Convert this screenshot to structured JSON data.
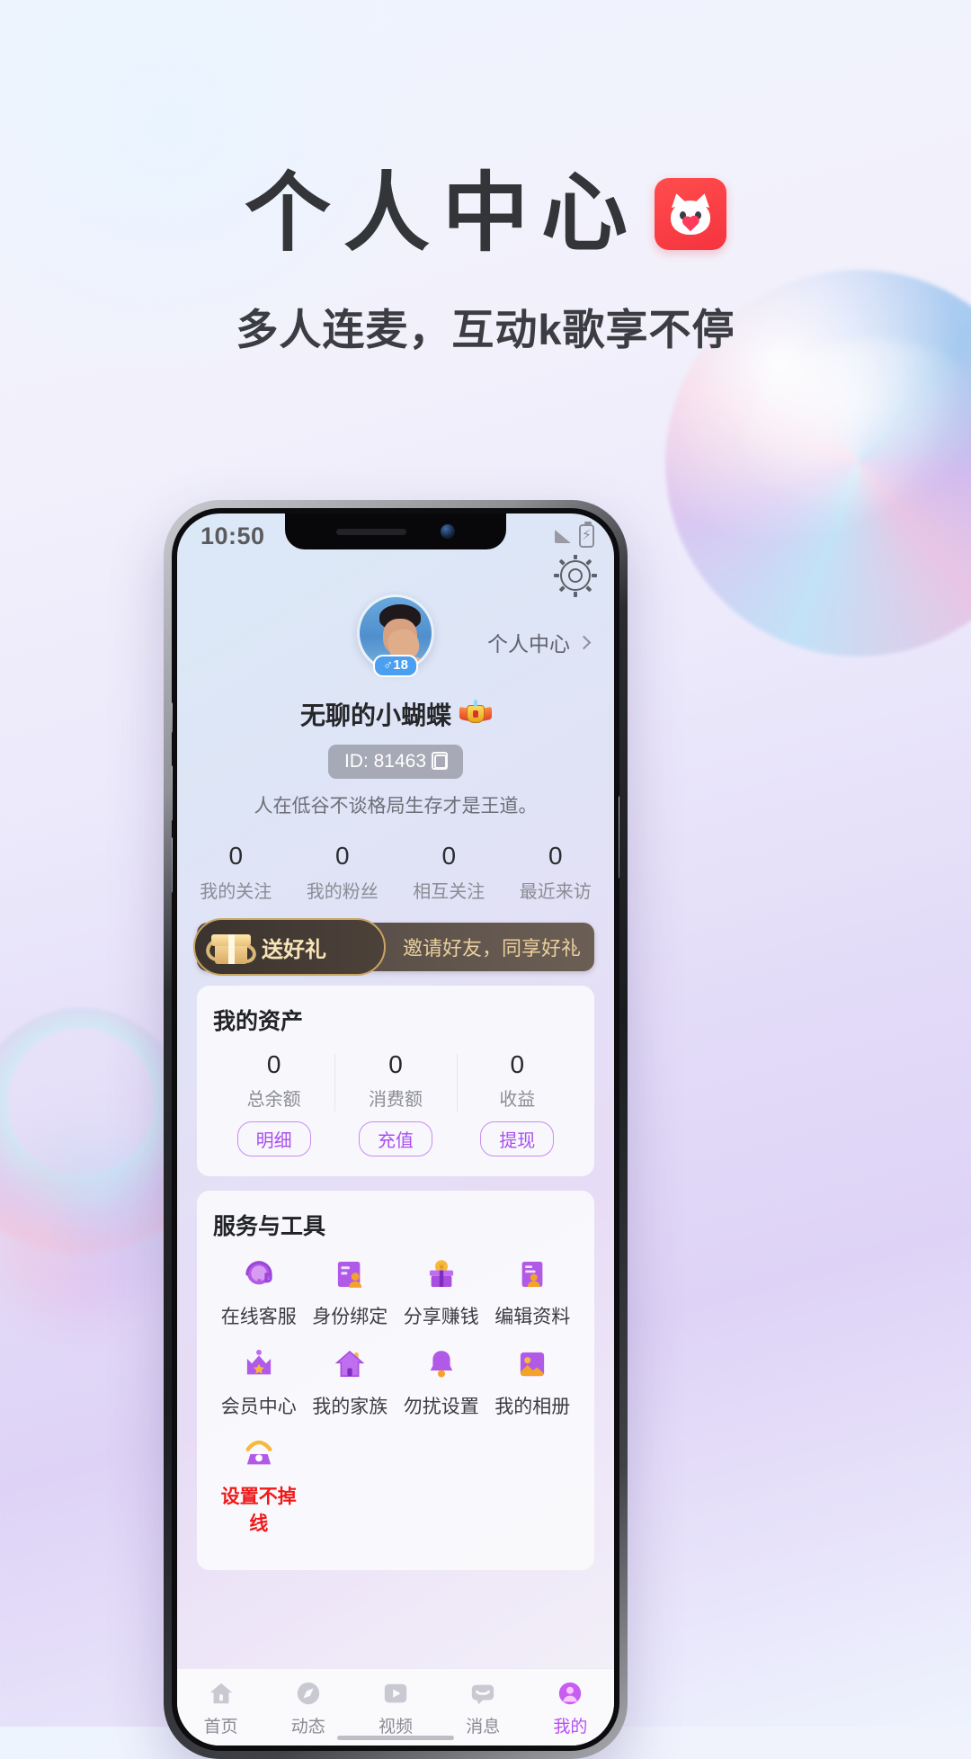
{
  "hero": {
    "title": "个人中心",
    "subtitle": "多人连麦，互动k歌享不停",
    "logo_icon": "cat-logo-icon",
    "title_color": "#333538",
    "logo_color": "#f5333f"
  },
  "phone": {
    "statusbar": {
      "time": "10:50",
      "signal_icon": "signal-icon",
      "battery_icon": "battery-charging-icon"
    },
    "settings_icon": "gear-icon",
    "profile": {
      "avatar_icon": "user-avatar",
      "gender_badge": "♂18",
      "personal_center_link": "个人中心",
      "chevron_icon": "chevron-right-icon",
      "nickname": "无聊的小蝴蝶",
      "level_badge_icon": "crown-badge-icon",
      "id_label": "ID: 81463",
      "copy_icon": "copy-icon",
      "bio": "人在低谷不谈格局生存才是王道。"
    },
    "stats": [
      {
        "value": "0",
        "label": "我的关注"
      },
      {
        "value": "0",
        "label": "我的粉丝"
      },
      {
        "value": "0",
        "label": "相互关注"
      },
      {
        "value": "0",
        "label": "最近来访"
      }
    ],
    "gift_banner": {
      "badge_label": "送好礼",
      "gift_icon": "gift-box-icon",
      "text": "邀请好友，同享好礼",
      "arrow": "›"
    },
    "assets": {
      "title": "我的资产",
      "items": [
        {
          "value": "0",
          "label": "总余额",
          "action": "明细"
        },
        {
          "value": "0",
          "label": "消费额",
          "action": "充值"
        },
        {
          "value": "0",
          "label": "收益",
          "action": "提现"
        }
      ],
      "accent_color": "#a84ff0"
    },
    "services": {
      "title": "服务与工具",
      "items": [
        {
          "label": "在线客服",
          "icon": "headset-support-icon"
        },
        {
          "label": "身份绑定",
          "icon": "id-card-icon"
        },
        {
          "label": "分享赚钱",
          "icon": "gift-money-icon"
        },
        {
          "label": "编辑资料",
          "icon": "edit-profile-icon"
        },
        {
          "label": "会员中心",
          "icon": "crown-icon"
        },
        {
          "label": "我的家族",
          "icon": "house-icon"
        },
        {
          "label": "勿扰设置",
          "icon": "bell-icon"
        },
        {
          "label": "我的相册",
          "icon": "photo-album-icon"
        },
        {
          "label": "设置不掉线",
          "icon": "telephone-icon",
          "alert": true
        }
      ],
      "alert_color": "#f01919"
    },
    "tabbar": {
      "items": [
        {
          "label": "首页",
          "icon": "home-icon",
          "active": false
        },
        {
          "label": "动态",
          "icon": "compass-icon",
          "active": false
        },
        {
          "label": "视频",
          "icon": "video-play-icon",
          "active": false
        },
        {
          "label": "消息",
          "icon": "message-icon",
          "active": false
        },
        {
          "label": "我的",
          "icon": "profile-circle-icon",
          "active": true
        }
      ],
      "active_color": "#b84ff5"
    }
  }
}
